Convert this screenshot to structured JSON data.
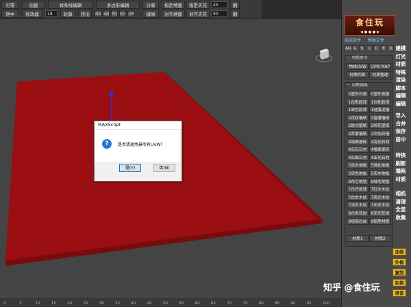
{
  "toolbar": {
    "row1": [
      "归零",
      "创建",
      "样条线编辑",
      "多边形编辑",
      "分离",
      "指定地面",
      "指定天花",
      "45",
      "翻"
    ],
    "row2": [
      "居中",
      "修改器",
      "18",
      "轮廓",
      "挤出",
      "焊接",
      "塌陷",
      "附加",
      "切片",
      "分离",
      "缝隙",
      "对齐地面",
      "对齐天花",
      "90",
      "翻"
    ]
  },
  "dialog": {
    "title": "MAXScript",
    "message": "是否清理场景所有UVW？",
    "yes": "是(Y)",
    "no": "否(N)"
  },
  "right_panel": {
    "logo": "食住玩",
    "logo_ctrl": "◀ ● ● ● ▶",
    "buy": "购买软件",
    "help": "帮助文件",
    "filters": [
      "ALL",
      "G",
      "S",
      "L",
      "C",
      "E",
      "D"
    ],
    "group1_title": "材质命令",
    "group1_btns": [
      "物体UVW",
      "UVW MAP",
      "材质列表",
      "材质管理"
    ],
    "group2_title": "材质调用",
    "group2_btns": [
      "0室外日景",
      "0室外夜景",
      "1白乳胶漆",
      "1白乳胶漆",
      "1单色胶漆",
      "1硅藻泥墙",
      "2花纹墙纸",
      "2普通墙纸",
      "2欧式壁纸",
      "2碎花壁纸",
      "2背景墙纸",
      "3文化砖墙",
      "4地面瓷砖",
      "4亮光石材",
      "4石石石材",
      "4墙面瓷砖",
      "4石面石材",
      "4亚光石材",
      "5实木地板",
      "5强化地板",
      "5实色地板",
      "5实木地板",
      "6布艺地毯",
      "6绒毛地毯",
      "7白开放漆",
      "7红木木纹",
      "7白木木纹",
      "7亮光木纹",
      "7浅木木纹",
      "7亚光木纹",
      "8白色花岗",
      "8亚光花岗",
      "9哑铝拉丝",
      "9铝型材质"
    ],
    "group2_foot": [
      "材质1",
      "材质2"
    ],
    "side_a": [
      "建模",
      "灯光",
      "材质",
      "特殊",
      "渲染",
      "脚本",
      "编辑",
      "编辑"
    ],
    "side_b": [
      "导入",
      "合并",
      "保存",
      "居中"
    ],
    "side_c": [
      "转换",
      "刷新",
      "塌陷",
      "材质"
    ],
    "side_d": [
      "相机",
      "清理",
      "全显",
      "收集"
    ],
    "yellow": [
      "冻结",
      "外框",
      "复制",
      "实例",
      "语音"
    ]
  },
  "ruler_ticks": [
    "0",
    "5",
    "10",
    "15",
    "20",
    "25",
    "30",
    "35",
    "40",
    "45",
    "50",
    "55",
    "60",
    "65",
    "70",
    "75",
    "80",
    "85",
    "90",
    "95",
    "100"
  ],
  "watermark": "知乎 @食住玩",
  "colors": {
    "plane": "#9b0f12",
    "plane_edge": "#7a0b0d",
    "viewport": "#444444",
    "accent": "#e8b62a"
  }
}
